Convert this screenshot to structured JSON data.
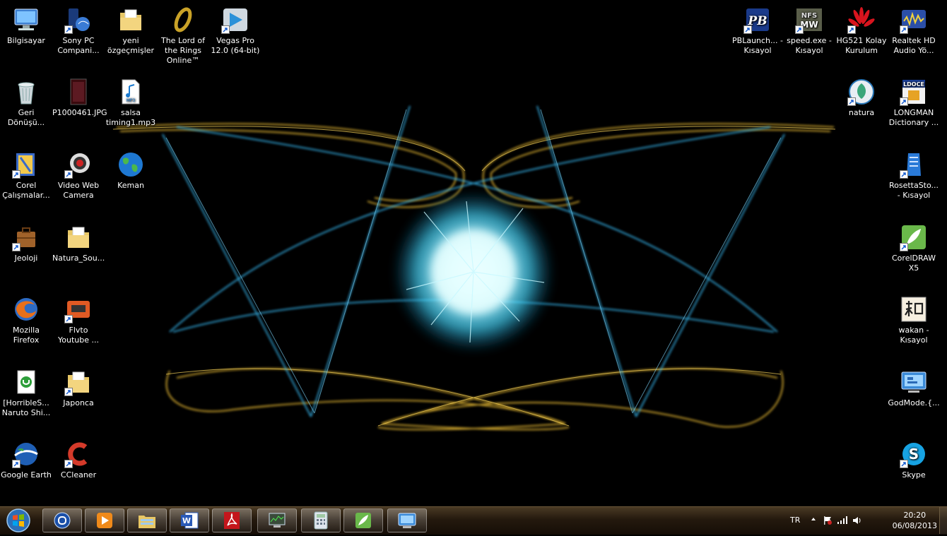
{
  "desktop": {
    "icons": [
      {
        "label": "Bilgisayar",
        "icon": "computer-icon"
      },
      {
        "label": "Sony PC Compani...",
        "icon": "sony-pc-companion-icon"
      },
      {
        "label": "yeni özgeçmişler",
        "icon": "folder-icon"
      },
      {
        "label": "The Lord of the Rings Online™",
        "icon": "lotro-ring-icon"
      },
      {
        "label": "Vegas Pro 12.0 (64-bit)",
        "icon": "vegas-pro-icon"
      },
      {
        "label": "Geri Dönüşü...",
        "icon": "recycle-bin-icon"
      },
      {
        "label": "P1000461.JPG",
        "icon": "jpg-image-icon"
      },
      {
        "label": "salsa timing1.mp3",
        "icon": "mp3-file-icon"
      },
      {
        "label": "Corel Çalışmalar...",
        "icon": "corel-folder-icon"
      },
      {
        "label": "Video Web Camera",
        "icon": "webcam-icon"
      },
      {
        "label": "Keman",
        "icon": "globe-icon"
      },
      {
        "label": "Jeoloji",
        "icon": "briefcase-icon"
      },
      {
        "label": "Natura_Sou...",
        "icon": "folder-icon"
      },
      {
        "label": "Mozilla Firefox",
        "icon": "firefox-icon"
      },
      {
        "label": "Flvto Youtube ...",
        "icon": "flvto-icon"
      },
      {
        "label": "[HorribleS... Naruto Shi...",
        "icon": "utorrent-icon"
      },
      {
        "label": "Japonca",
        "icon": "folder-icon"
      },
      {
        "label": "Google Earth",
        "icon": "google-earth-icon"
      },
      {
        "label": "CCleaner",
        "icon": "ccleaner-icon"
      },
      {
        "label": "PBLaunch... - Kısayol",
        "icon": "pb-launcher-icon"
      },
      {
        "label": "speed.exe - Kısayol",
        "icon": "nfs-speed-icon"
      },
      {
        "label": "HG521 Kolay Kurulum",
        "icon": "huawei-icon"
      },
      {
        "label": "Realtek HD Audio Yö...",
        "icon": "realtek-audio-icon"
      },
      {
        "label": "natura",
        "icon": "natura-icon"
      },
      {
        "label": "LONGMAN Dictionary ...",
        "icon": "longman-icon"
      },
      {
        "label": "RosettaSto... - Kısayol",
        "icon": "rosetta-stone-icon"
      },
      {
        "label": "CorelDRAW X5",
        "icon": "coreldraw-icon"
      },
      {
        "label": "wakan - Kısayol",
        "icon": "wakan-icon"
      },
      {
        "label": "GodMode.{...",
        "icon": "control-panel-icon"
      },
      {
        "label": "Skype",
        "icon": "skype-icon"
      }
    ]
  },
  "taskbar": {
    "start_icon": "windows-orb-icon",
    "pinned": [
      {
        "icon": "sony-pc-companion-icon"
      },
      {
        "icon": "media-player-icon"
      },
      {
        "icon": "explorer-folder-icon"
      },
      {
        "icon": "word-icon"
      },
      {
        "icon": "acrobat-icon"
      },
      {
        "icon": "task-manager-icon"
      },
      {
        "icon": "calculator-icon"
      },
      {
        "icon": "coreldraw-icon"
      },
      {
        "icon": "control-panel-icon"
      }
    ],
    "tray": {
      "language": "TR",
      "time": "20:20",
      "date": "06/08/2013"
    }
  },
  "colors": {
    "wallpaper_bg": "#000000",
    "gold_ribbon": "#e2b532",
    "blue_beam": "#38b8f0",
    "center_glow": "#a9f4ff",
    "taskbar": "#24190e"
  }
}
